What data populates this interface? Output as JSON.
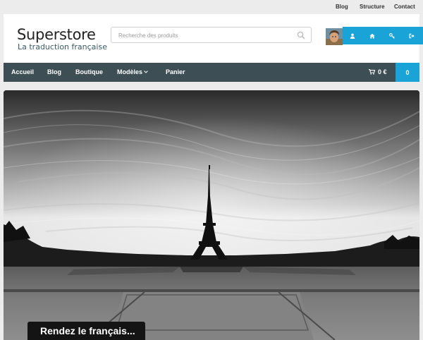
{
  "topnav": [
    "Blog",
    "Structure",
    "Contact"
  ],
  "logo": {
    "title": "Superstore",
    "subtitle": "La traduction française"
  },
  "search": {
    "placeholder": "Recherche des produits"
  },
  "user_actions": [
    "user-icon",
    "home-icon",
    "key-icon",
    "sign-out-icon"
  ],
  "nav": {
    "items": [
      "Accueil",
      "Blog",
      "Boutique",
      "Modèles",
      "Panier"
    ],
    "cart_total": "0 €",
    "cart_count": "0"
  },
  "hero": {
    "caption": "Rendez le français..."
  },
  "colors": {
    "accent": "#1aa3d6",
    "nav_bg": "#3e4e55",
    "page_bg": "#ececec"
  }
}
